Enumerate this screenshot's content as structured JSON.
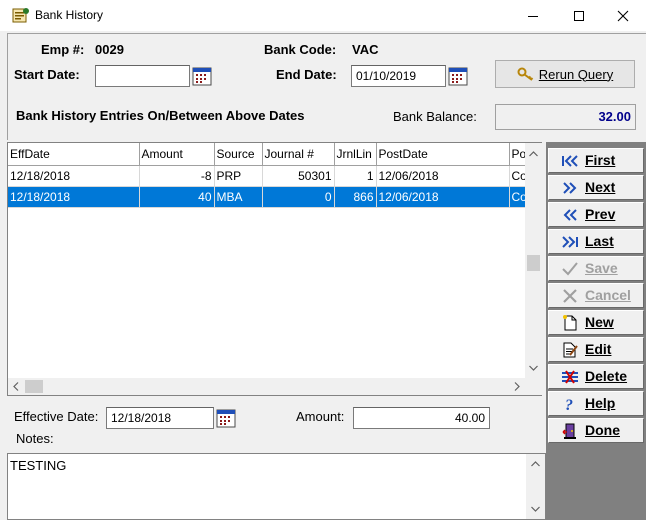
{
  "window": {
    "title": "Bank History"
  },
  "header": {
    "emp_label": "Emp #:",
    "emp_value": "0029",
    "bank_code_label": "Bank Code:",
    "bank_code_value": "VAC",
    "start_date_label": "Start Date:",
    "start_date_value": "",
    "end_date_label": "End Date:",
    "end_date_value": "01/10/2019",
    "rerun_label": "Rerun Query",
    "entries_heading": "Bank History Entries On/Between Above Dates",
    "balance_label": "Bank Balance:",
    "balance_value": "32.00"
  },
  "grid": {
    "columns": [
      "EffDate",
      "Amount",
      "Source",
      "Journal #",
      "JrnlLin",
      "PostDate",
      "Po"
    ],
    "rows": [
      [
        "12/18/2018",
        "-8",
        "PRP",
        "50301",
        "1",
        "12/06/2018",
        "Co"
      ],
      [
        "12/18/2018",
        "40",
        "MBA",
        "0",
        "866",
        "12/06/2018",
        "Co"
      ]
    ],
    "selected_row": 1
  },
  "detail": {
    "effective_date_label": "Effective Date:",
    "effective_date_value": "12/18/2018",
    "amount_label": "Amount:",
    "amount_value": "40.00",
    "notes_label": "Notes:",
    "notes_value": "TESTING"
  },
  "side_buttons": [
    {
      "label": "First",
      "icon": "first-icon",
      "enabled": true
    },
    {
      "label": "Next",
      "icon": "next-icon",
      "enabled": true
    },
    {
      "label": "Prev",
      "icon": "prev-icon",
      "enabled": true
    },
    {
      "label": "Last",
      "icon": "last-icon",
      "enabled": true
    },
    {
      "label": "Save",
      "icon": "save-check-icon",
      "enabled": false
    },
    {
      "label": "Cancel",
      "icon": "cancel-x-icon",
      "enabled": false
    },
    {
      "label": "New",
      "icon": "new-document-icon",
      "enabled": true
    },
    {
      "label": "Edit",
      "icon": "edit-document-icon",
      "enabled": true
    },
    {
      "label": "Delete",
      "icon": "delete-icon",
      "enabled": true
    },
    {
      "label": "Help",
      "icon": "help-icon",
      "enabled": true
    },
    {
      "label": "Done",
      "icon": "done-door-icon",
      "enabled": true
    }
  ],
  "colors": {
    "selection": "#0078d7",
    "balance_text": "#00008b",
    "icon_blue": "#1f4fb8"
  }
}
